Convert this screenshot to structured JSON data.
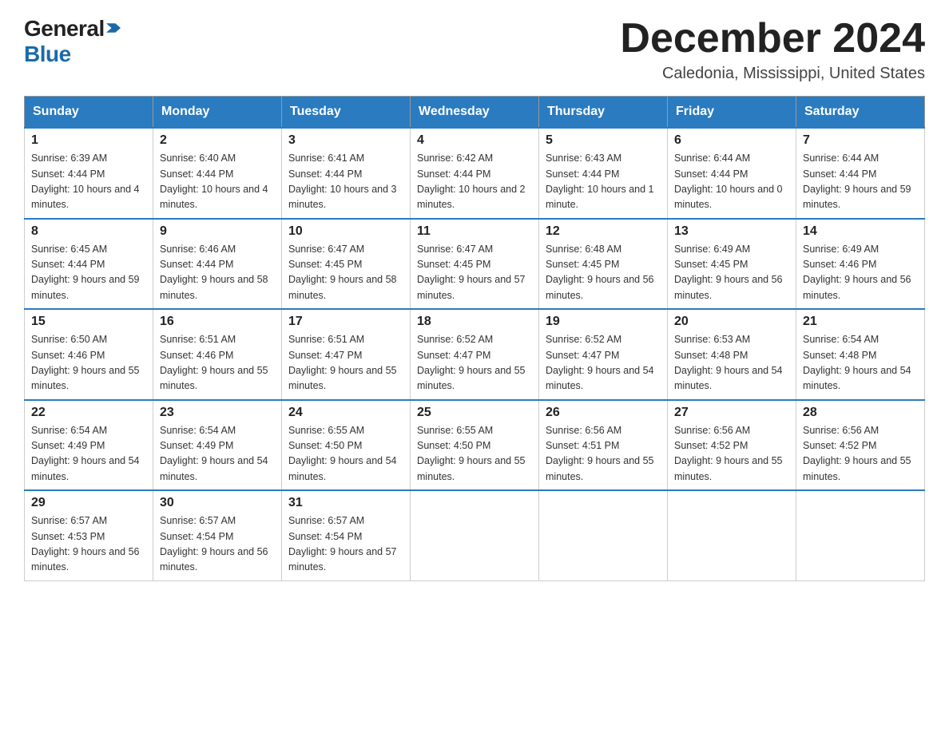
{
  "logo": {
    "general": "General",
    "blue": "Blue",
    "arrow": "▶"
  },
  "title": {
    "month": "December 2024",
    "location": "Caledonia, Mississippi, United States"
  },
  "weekdays": [
    "Sunday",
    "Monday",
    "Tuesday",
    "Wednesday",
    "Thursday",
    "Friday",
    "Saturday"
  ],
  "weeks": [
    [
      {
        "day": "1",
        "sunrise": "6:39 AM",
        "sunset": "4:44 PM",
        "daylight": "10 hours and 4 minutes."
      },
      {
        "day": "2",
        "sunrise": "6:40 AM",
        "sunset": "4:44 PM",
        "daylight": "10 hours and 4 minutes."
      },
      {
        "day": "3",
        "sunrise": "6:41 AM",
        "sunset": "4:44 PM",
        "daylight": "10 hours and 3 minutes."
      },
      {
        "day": "4",
        "sunrise": "6:42 AM",
        "sunset": "4:44 PM",
        "daylight": "10 hours and 2 minutes."
      },
      {
        "day": "5",
        "sunrise": "6:43 AM",
        "sunset": "4:44 PM",
        "daylight": "10 hours and 1 minute."
      },
      {
        "day": "6",
        "sunrise": "6:44 AM",
        "sunset": "4:44 PM",
        "daylight": "10 hours and 0 minutes."
      },
      {
        "day": "7",
        "sunrise": "6:44 AM",
        "sunset": "4:44 PM",
        "daylight": "9 hours and 59 minutes."
      }
    ],
    [
      {
        "day": "8",
        "sunrise": "6:45 AM",
        "sunset": "4:44 PM",
        "daylight": "9 hours and 59 minutes."
      },
      {
        "day": "9",
        "sunrise": "6:46 AM",
        "sunset": "4:44 PM",
        "daylight": "9 hours and 58 minutes."
      },
      {
        "day": "10",
        "sunrise": "6:47 AM",
        "sunset": "4:45 PM",
        "daylight": "9 hours and 58 minutes."
      },
      {
        "day": "11",
        "sunrise": "6:47 AM",
        "sunset": "4:45 PM",
        "daylight": "9 hours and 57 minutes."
      },
      {
        "day": "12",
        "sunrise": "6:48 AM",
        "sunset": "4:45 PM",
        "daylight": "9 hours and 56 minutes."
      },
      {
        "day": "13",
        "sunrise": "6:49 AM",
        "sunset": "4:45 PM",
        "daylight": "9 hours and 56 minutes."
      },
      {
        "day": "14",
        "sunrise": "6:49 AM",
        "sunset": "4:46 PM",
        "daylight": "9 hours and 56 minutes."
      }
    ],
    [
      {
        "day": "15",
        "sunrise": "6:50 AM",
        "sunset": "4:46 PM",
        "daylight": "9 hours and 55 minutes."
      },
      {
        "day": "16",
        "sunrise": "6:51 AM",
        "sunset": "4:46 PM",
        "daylight": "9 hours and 55 minutes."
      },
      {
        "day": "17",
        "sunrise": "6:51 AM",
        "sunset": "4:47 PM",
        "daylight": "9 hours and 55 minutes."
      },
      {
        "day": "18",
        "sunrise": "6:52 AM",
        "sunset": "4:47 PM",
        "daylight": "9 hours and 55 minutes."
      },
      {
        "day": "19",
        "sunrise": "6:52 AM",
        "sunset": "4:47 PM",
        "daylight": "9 hours and 54 minutes."
      },
      {
        "day": "20",
        "sunrise": "6:53 AM",
        "sunset": "4:48 PM",
        "daylight": "9 hours and 54 minutes."
      },
      {
        "day": "21",
        "sunrise": "6:54 AM",
        "sunset": "4:48 PM",
        "daylight": "9 hours and 54 minutes."
      }
    ],
    [
      {
        "day": "22",
        "sunrise": "6:54 AM",
        "sunset": "4:49 PM",
        "daylight": "9 hours and 54 minutes."
      },
      {
        "day": "23",
        "sunrise": "6:54 AM",
        "sunset": "4:49 PM",
        "daylight": "9 hours and 54 minutes."
      },
      {
        "day": "24",
        "sunrise": "6:55 AM",
        "sunset": "4:50 PM",
        "daylight": "9 hours and 54 minutes."
      },
      {
        "day": "25",
        "sunrise": "6:55 AM",
        "sunset": "4:50 PM",
        "daylight": "9 hours and 55 minutes."
      },
      {
        "day": "26",
        "sunrise": "6:56 AM",
        "sunset": "4:51 PM",
        "daylight": "9 hours and 55 minutes."
      },
      {
        "day": "27",
        "sunrise": "6:56 AM",
        "sunset": "4:52 PM",
        "daylight": "9 hours and 55 minutes."
      },
      {
        "day": "28",
        "sunrise": "6:56 AM",
        "sunset": "4:52 PM",
        "daylight": "9 hours and 55 minutes."
      }
    ],
    [
      {
        "day": "29",
        "sunrise": "6:57 AM",
        "sunset": "4:53 PM",
        "daylight": "9 hours and 56 minutes."
      },
      {
        "day": "30",
        "sunrise": "6:57 AM",
        "sunset": "4:54 PM",
        "daylight": "9 hours and 56 minutes."
      },
      {
        "day": "31",
        "sunrise": "6:57 AM",
        "sunset": "4:54 PM",
        "daylight": "9 hours and 57 minutes."
      },
      null,
      null,
      null,
      null
    ]
  ]
}
